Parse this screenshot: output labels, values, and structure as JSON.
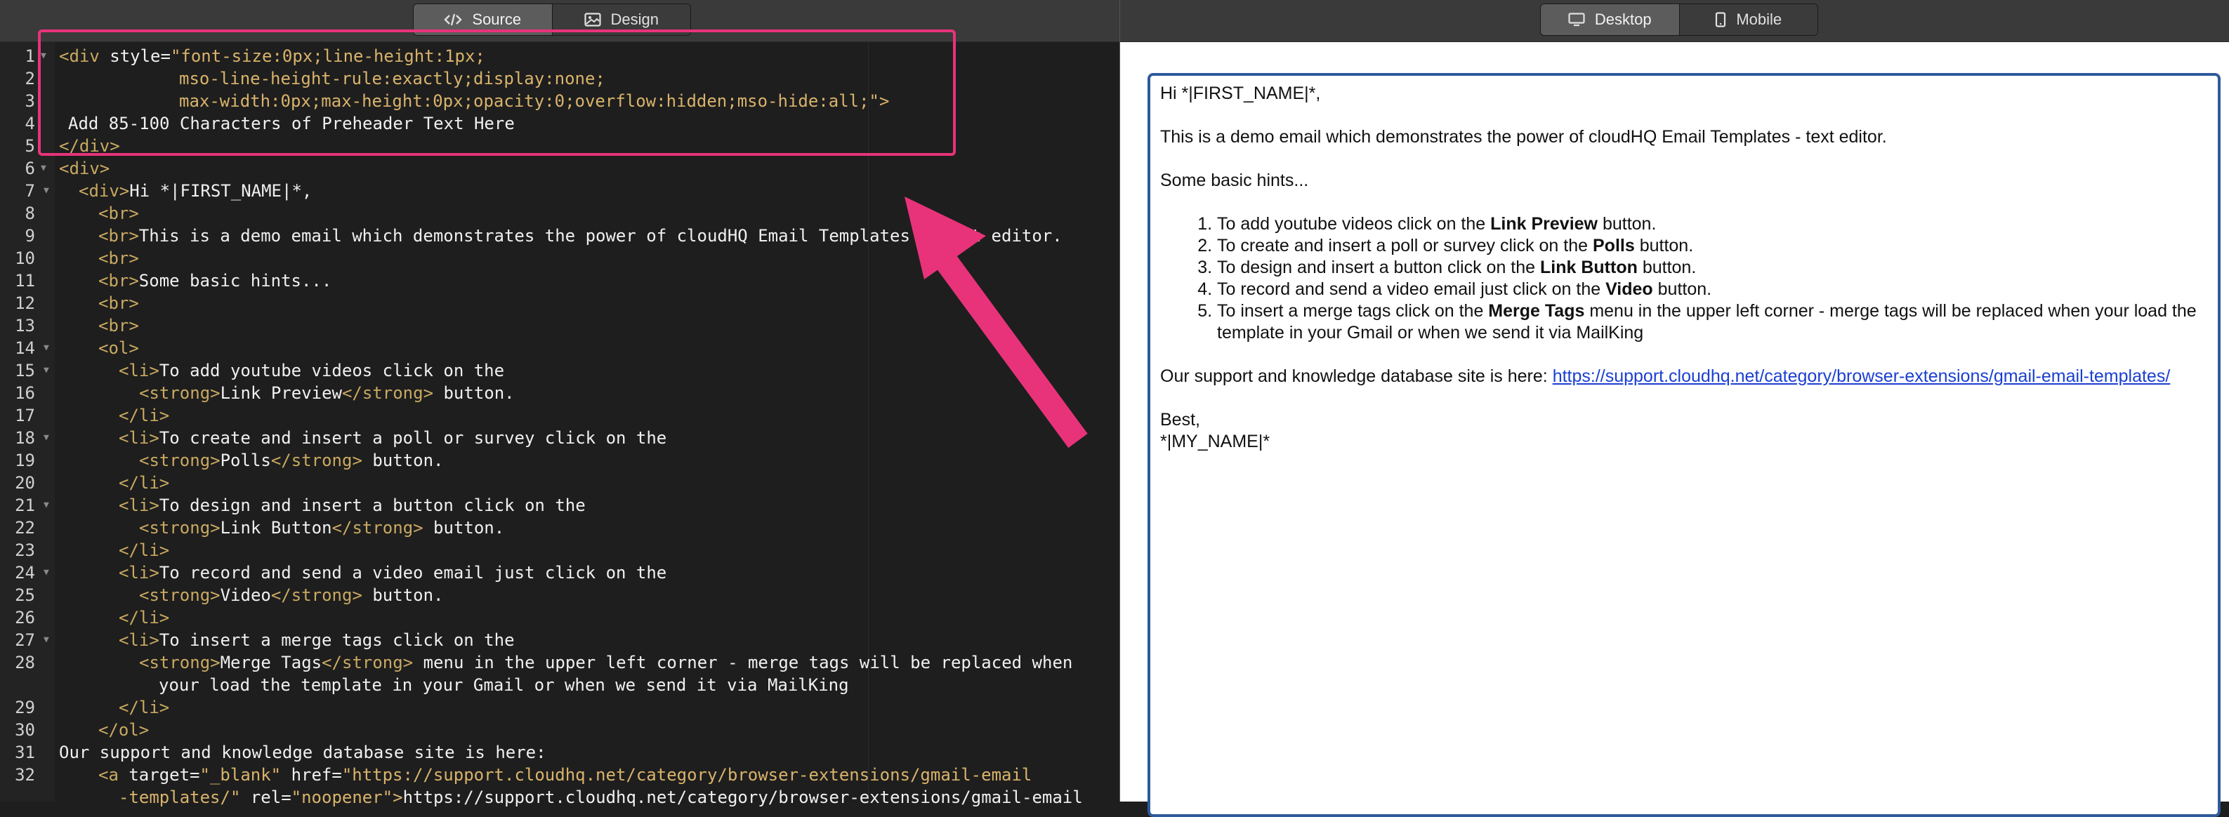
{
  "source_tabs": [
    {
      "label": "Source",
      "icon": "code-icon",
      "active": true
    },
    {
      "label": "Design",
      "icon": "image-icon",
      "active": false
    }
  ],
  "preview_tabs": [
    {
      "label": "Desktop",
      "icon": "desktop-icon",
      "active": true
    },
    {
      "label": "Mobile",
      "icon": "mobile-icon",
      "active": false
    }
  ],
  "code": {
    "line_numbers": [
      "1",
      "2",
      "3",
      "4",
      "5",
      "6",
      "7",
      "8",
      "9",
      "10",
      "11",
      "12",
      "13",
      "14",
      "15",
      "16",
      "17",
      "18",
      "19",
      "20",
      "21",
      "22",
      "23",
      "24",
      "25",
      "26",
      "27",
      "28",
      "",
      "29",
      "30",
      "31",
      "32",
      ""
    ],
    "l1_a": "<div ",
    "l1_b": "style=",
    "l1_c": "\"font-size:0px;line-height:1px;",
    "l2": "mso-line-height-rule:exactly;display:none;",
    "l3": "max-width:0px;max-height:0px;opacity:0;overflow:hidden;mso-hide:all;\">",
    "l4": "Add 85-100 Characters of Preheader Text Here",
    "l5": "</div>",
    "l6": "<div>",
    "l7_a": "<div>",
    "l7_b": "Hi *|FIRST_NAME|*,",
    "l8": "<br>",
    "l9_a": "<br>",
    "l9_b": "This is a demo email which demonstrates the power of cloudHQ Email Templates - text editor.",
    "l10": "<br>",
    "l11_a": "<br>",
    "l11_b": "Some basic hints...",
    "l12": "<br>",
    "l13": "<br>",
    "l14": "<ol>",
    "l15_a": "<li>",
    "l15_b": "To add youtube videos click on the",
    "l16_a": "<strong>",
    "l16_b": "Link Preview",
    "l16_c": "</strong>",
    "l16_d": " button.",
    "l17": "</li>",
    "l18_a": "<li>",
    "l18_b": "To create and insert a poll or survey click on the",
    "l19_a": "<strong>",
    "l19_b": "Polls",
    "l19_c": "</strong>",
    "l19_d": " button.",
    "l20": "</li>",
    "l21_a": "<li>",
    "l21_b": "To design and insert a button click on the",
    "l22_a": "<strong>",
    "l22_b": "Link Button",
    "l22_c": "</strong>",
    "l22_d": " button.",
    "l23": "</li>",
    "l24_a": "<li>",
    "l24_b": "To record and send a video email just click on the",
    "l25_a": "<strong>",
    "l25_b": "Video",
    "l25_c": "</strong>",
    "l25_d": " button.",
    "l26": "</li>",
    "l27_a": "<li>",
    "l27_b": "To insert a merge tags click on the",
    "l28_a": "<strong>",
    "l28_b": "Merge Tags",
    "l28_c": "</strong>",
    "l28_d": " menu in the upper left corner - merge tags will be replaced when",
    "l28w": "your load the template in your Gmail or when we send it via MailKing",
    "l29": "</li>",
    "l30": "</ol>",
    "l31": "Our support and knowledge database site is here:",
    "l32_a": "<a ",
    "l32_b": "target=",
    "l32_c": "\"_blank\" ",
    "l32_d": "href=",
    "l32_e": "\"https://support.cloudhq.net/category/browser-extensions/gmail-email",
    "l32w_a": "-templates/\" ",
    "l32w_b": "rel=",
    "l32w_c": "\"noopener\">",
    "l32w_d": "https://support.cloudhq.net/category/browser-extensions/gmail-email"
  },
  "email": {
    "greeting": "Hi *|FIRST_NAME|*,",
    "intro": "This is a demo email which demonstrates the power of cloudHQ Email Templates - text editor.",
    "hints": "Some basic hints...",
    "items": [
      {
        "pre": "To add youtube videos click on the ",
        "bold": "Link Preview",
        "post": " button."
      },
      {
        "pre": "To create and insert a poll or survey click on the ",
        "bold": "Polls",
        "post": " button."
      },
      {
        "pre": "To design and insert a button click on the ",
        "bold": "Link Button",
        "post": " button."
      },
      {
        "pre": "To record and send a video email just click on the ",
        "bold": "Video",
        "post": " button."
      },
      {
        "pre": "To insert a merge tags click on the ",
        "bold": "Merge Tags",
        "post": " menu in the upper left corner - merge tags will be replaced when your load the template in your Gmail or when we send it via MailKing"
      }
    ],
    "support_text": "Our support and knowledge database site is here: ",
    "support_link": "https://support.cloudhq.net/category/browser-extensions/gmail-email-templates/",
    "signoff": "Best,",
    "signature": "*|MY_NAME|*"
  },
  "colors": {
    "highlight": "#e8337a",
    "frame": "#2e5a9c",
    "tag": "#c9a961",
    "string": "#d9b36b",
    "link": "#1a3fd1"
  }
}
